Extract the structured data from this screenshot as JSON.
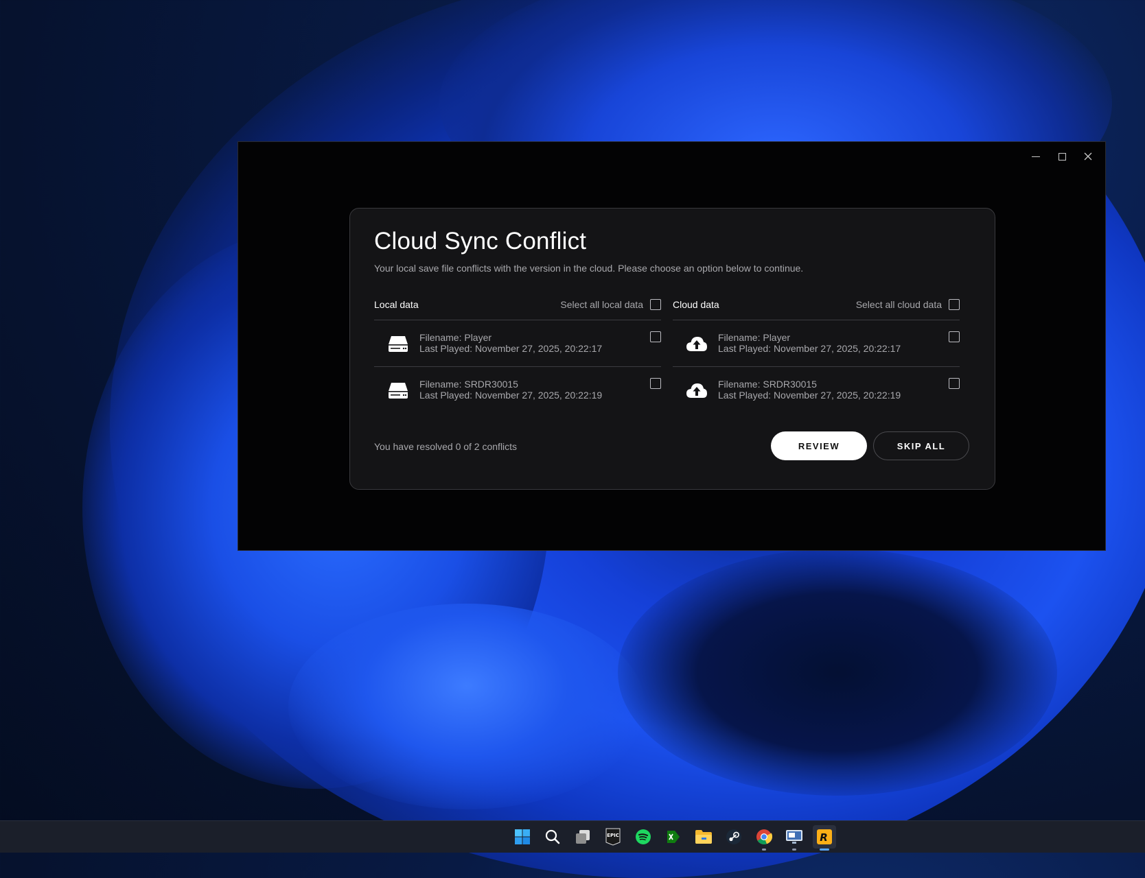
{
  "window": {
    "controls": {
      "minimize": "minimize-icon",
      "maximize": "maximize-icon",
      "close": "close-icon"
    }
  },
  "dialog": {
    "title": "Cloud Sync Conflict",
    "subtitle": "Your local save file conflicts with the version in the cloud. Please choose an option below to continue.",
    "local": {
      "header": "Local data",
      "select_all": "Select all local data",
      "icon": "hard-drive-icon",
      "rows": [
        {
          "filename": "Filename: Player",
          "last_played": "Last Played: November 27, 2025, 20:22:17"
        },
        {
          "filename": "Filename: SRDR30015",
          "last_played": "Last Played: November 27, 2025, 20:22:19"
        }
      ]
    },
    "cloud": {
      "header": "Cloud data",
      "select_all": "Select all cloud data",
      "icon": "cloud-upload-icon",
      "rows": [
        {
          "filename": "Filename: Player",
          "last_played": "Last Played: November 27, 2025, 20:22:17"
        },
        {
          "filename": "Filename: SRDR30015",
          "last_played": "Last Played: November 27, 2025, 20:22:19"
        }
      ]
    },
    "status": "You have resolved 0 of 2 conflicts",
    "review_label": "REVIEW",
    "skip_label": "SKIP ALL"
  },
  "taskbar": {
    "items": [
      "windows-start-icon",
      "search-icon",
      "task-view-icon",
      "epic-games-icon",
      "spotify-icon",
      "xbox-game-bar-icon",
      "file-explorer-icon",
      "steam-icon",
      "chrome-icon",
      "remote-desktop-icon",
      "rockstar-launcher-icon"
    ],
    "epic_text": "EPIC",
    "rockstar_text": "R"
  },
  "colors": {
    "dialog_bg": "#141416",
    "window_bg": "#030304",
    "text_primary": "#ffffff",
    "text_secondary": "#a8a8ac",
    "wallpaper_accent": "#1c52f0"
  }
}
